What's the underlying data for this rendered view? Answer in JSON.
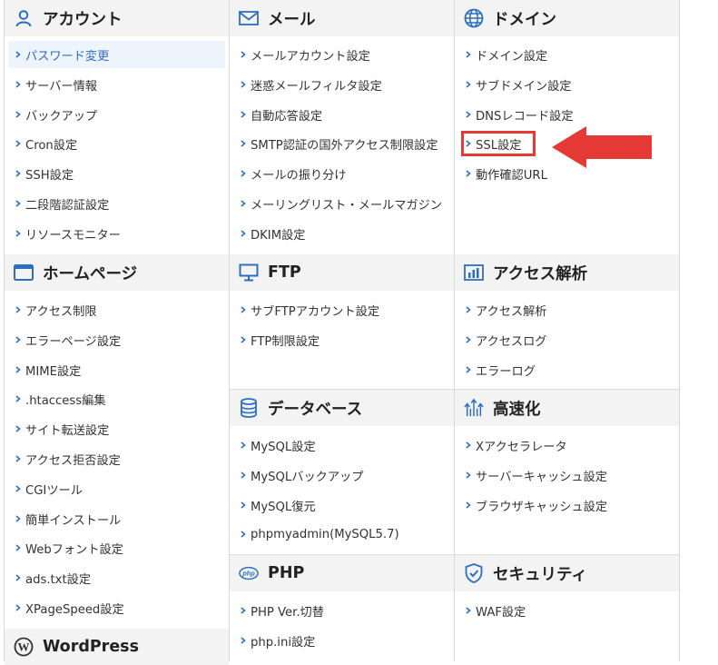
{
  "colors": {
    "accent": "#2c6fc0",
    "header_bg": "#f3f3f3",
    "highlight": "#e53935",
    "active_bg": "#eef4fb"
  },
  "sections": {
    "account": {
      "icon": "user-icon",
      "title": "アカウント",
      "items": [
        "パスワード変更",
        "サーバー情報",
        "バックアップ",
        "Cron設定",
        "SSH設定",
        "二段階認証設定",
        "リソースモニター"
      ],
      "active": "パスワード変更"
    },
    "mail": {
      "icon": "mail-icon",
      "title": "メール",
      "items": [
        "メールアカウント設定",
        "迷惑メールフィルタ設定",
        "自動応答設定",
        "SMTP認証の国外アクセス制限設定",
        "メールの振り分け",
        "メーリングリスト・メールマガジン",
        "DKIM設定"
      ]
    },
    "domain": {
      "icon": "globe-icon",
      "title": "ドメイン",
      "items": [
        "ドメイン設定",
        "サブドメイン設定",
        "DNSレコード設定",
        "SSL設定",
        "動作確認URL"
      ],
      "highlighted": "SSL設定"
    },
    "homepage": {
      "icon": "browser-window-icon",
      "title": "ホームページ",
      "items": [
        "アクセス制限",
        "エラーページ設定",
        "MIME設定",
        ".htaccess編集",
        "サイト転送設定",
        "アクセス拒否設定",
        "CGIツール",
        "簡単インストール",
        "Webフォント設定",
        "ads.txt設定",
        "XPageSpeed設定"
      ]
    },
    "ftp": {
      "icon": "monitor-icon",
      "title": "FTP",
      "items": [
        "サブFTPアカウント設定",
        "FTP制限設定"
      ]
    },
    "access": {
      "icon": "bar-chart-icon",
      "title": "アクセス解析",
      "items": [
        "アクセス解析",
        "アクセスログ",
        "エラーログ"
      ]
    },
    "database": {
      "icon": "database-icon",
      "title": "データベース",
      "items": [
        "MySQL設定",
        "MySQLバックアップ",
        "MySQL復元",
        "phpmyadmin(MySQL5.7)"
      ]
    },
    "speed": {
      "icon": "speed-arrows-icon",
      "title": "高速化",
      "items": [
        "Xアクセラレータ",
        "サーバーキャッシュ設定",
        "ブラウザキャッシュ設定"
      ]
    },
    "php": {
      "icon": "php-icon",
      "title": "PHP",
      "items": [
        "PHP Ver.切替",
        "php.ini設定"
      ]
    },
    "security": {
      "icon": "shield-icon",
      "title": "セキュリティ",
      "items": [
        "WAF設定"
      ]
    },
    "wordpress": {
      "icon": "wordpress-icon",
      "title": "WordPress"
    }
  }
}
